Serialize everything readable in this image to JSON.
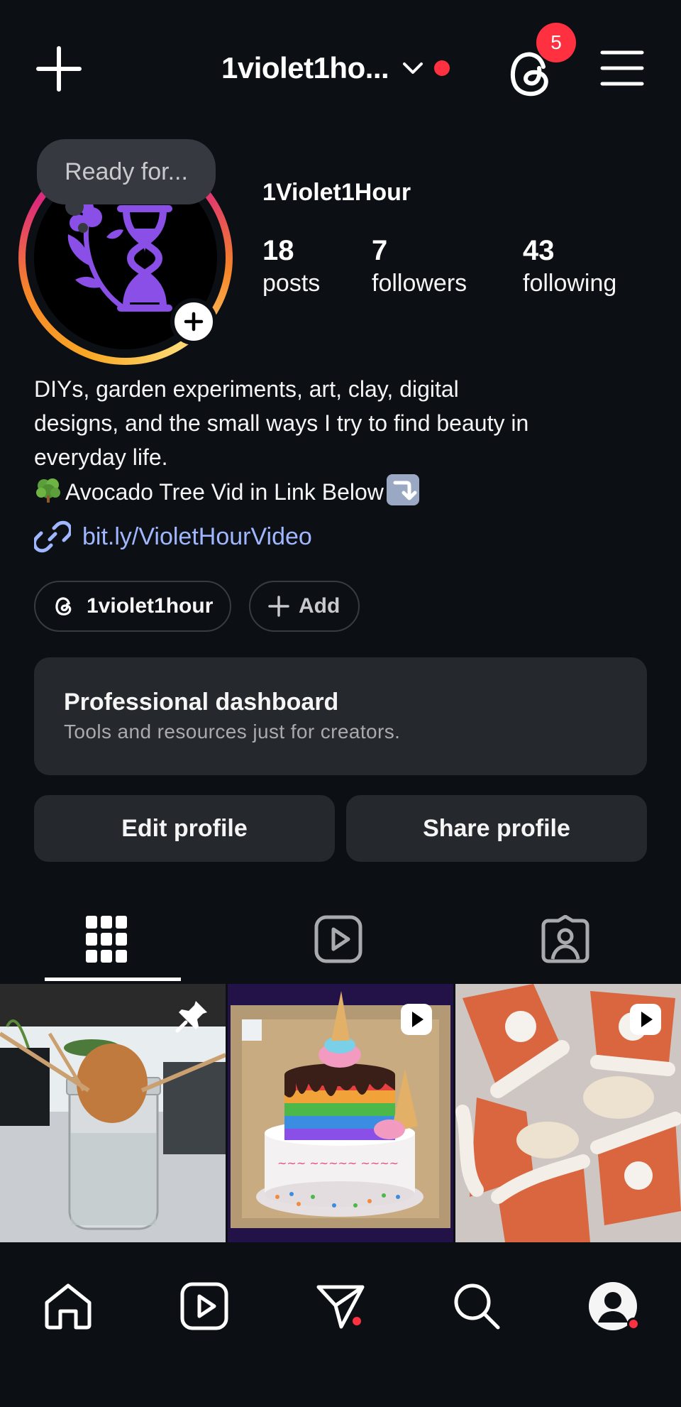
{
  "header": {
    "username": "1violet1ho...",
    "notification_badge": "5",
    "accent_red": "#ff3040"
  },
  "note": {
    "text": "Ready for..."
  },
  "profile": {
    "display_name": "1Violet1Hour",
    "stats": [
      {
        "value": "18",
        "label": "posts"
      },
      {
        "value": "7",
        "label": "followers"
      },
      {
        "value": "43",
        "label": "following"
      }
    ],
    "bio_lines": [
      "DIYs, garden experiments, art, clay, digital",
      "designs, and the small ways I try to find beauty in",
      "everyday life."
    ],
    "bio_link_line": "Avocado Tree Vid in Link Below",
    "link": "bit.ly/VioletHourVideo",
    "link_color": "#a0b6ff"
  },
  "pills": {
    "threads_handle": "1violet1hour",
    "add_label": "Add"
  },
  "dashboard": {
    "title": "Professional dashboard",
    "subtitle": "Tools and resources just for creators."
  },
  "buttons": {
    "edit": "Edit profile",
    "share": "Share profile"
  },
  "tabs": [
    {
      "icon": "grid-icon",
      "active": true
    },
    {
      "icon": "reels-icon",
      "active": false
    },
    {
      "icon": "tagged-icon",
      "active": false
    }
  ],
  "grid_posts": [
    {
      "subject": "avocado seed in jar",
      "badge": "pin-icon"
    },
    {
      "subject": "rainbow drip birthday cake",
      "badge": "reel-icon"
    },
    {
      "subject": "pie slice cupcakes",
      "badge": "reel-icon"
    }
  ],
  "bottom_nav": [
    {
      "icon": "home-icon"
    },
    {
      "icon": "reels-icon"
    },
    {
      "icon": "direct-message-icon",
      "dot": true
    },
    {
      "icon": "search-icon"
    },
    {
      "icon": "profile-icon",
      "dot": true
    }
  ]
}
